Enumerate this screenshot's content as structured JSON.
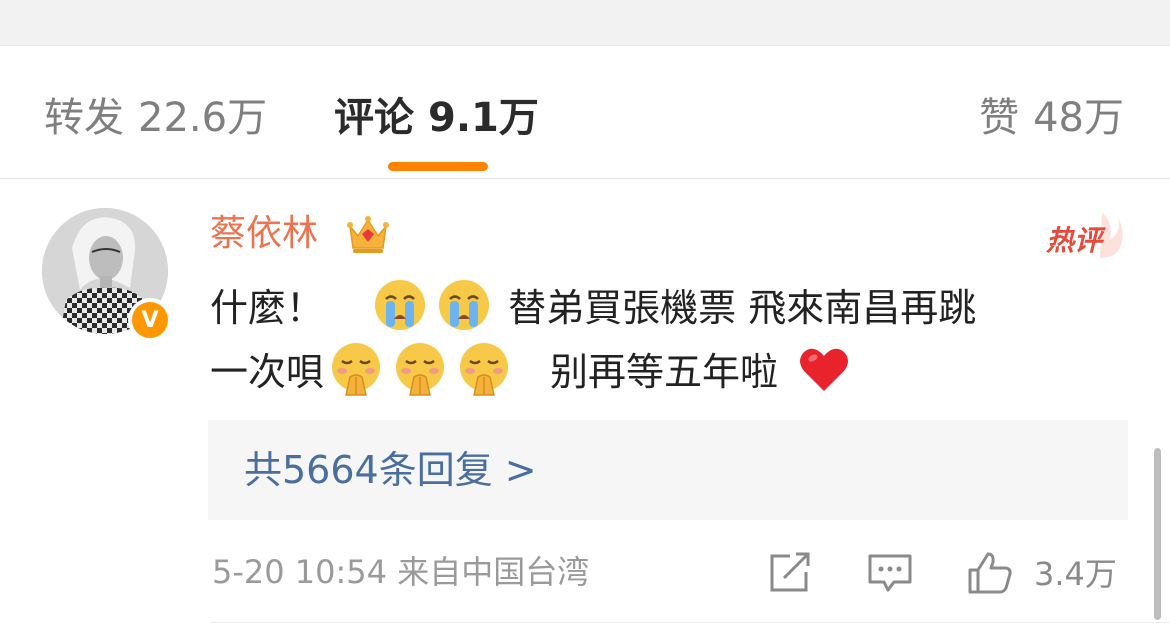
{
  "tabs": {
    "repost": {
      "label": "转发",
      "count": "22.6万"
    },
    "comment": {
      "label": "评论",
      "count": "9.1万"
    },
    "like": {
      "label": "赞",
      "count": "48万"
    }
  },
  "comment": {
    "username": "蔡依林",
    "hot_tag": "热评",
    "verified_badge": "V",
    "text_part1": "什麼！",
    "text_part2": "替弟買張機票 飛來南昌再跳",
    "text_part3": "一次唄",
    "text_part4": "别再等五年啦",
    "emojis": [
      "crying-face-emoji",
      "crying-face-emoji",
      "pleading-hands-emoji",
      "pleading-hands-emoji",
      "pleading-hands-emoji",
      "red-heart-emoji"
    ],
    "replies_label": "共5664条回复 >",
    "timestamp": "5-20 10:54",
    "source": "来自中国台湾",
    "like_count": "3.4万"
  },
  "colors": {
    "accent": "#ff8200",
    "username": "#eb7350",
    "link": "#4a6f9c",
    "hot": "#e64a3c"
  }
}
